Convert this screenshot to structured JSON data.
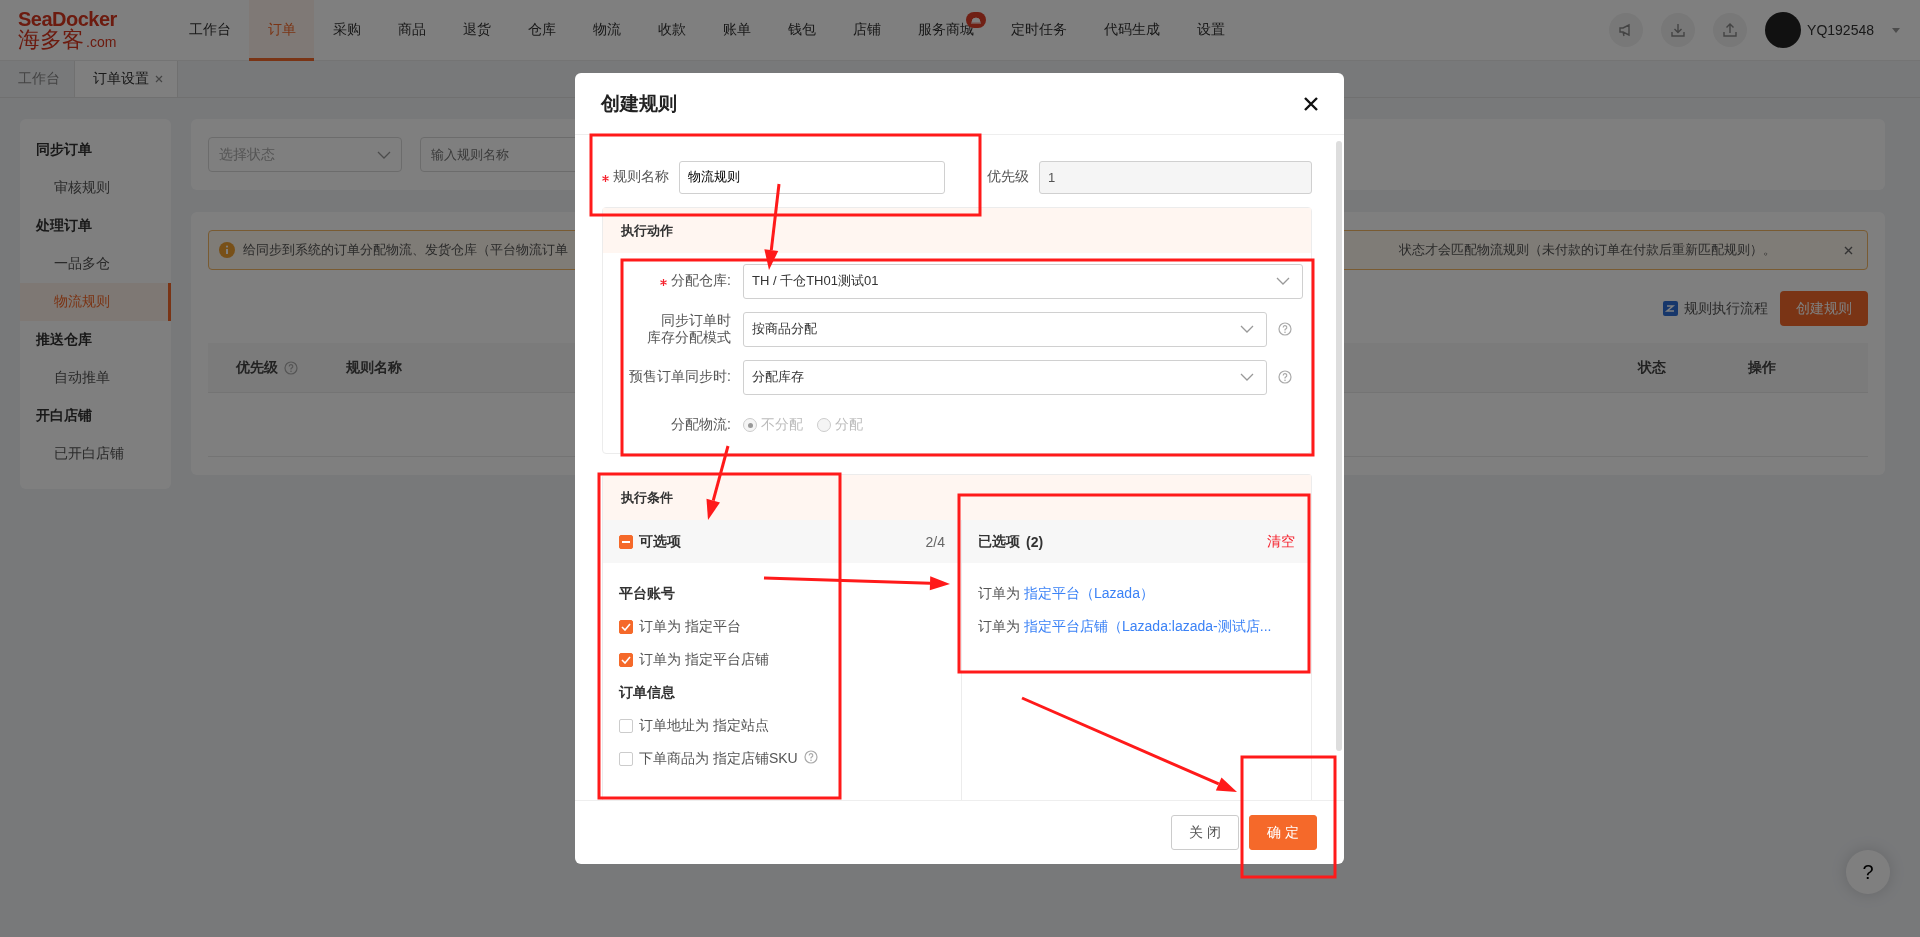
{
  "header": {
    "logo": {
      "brand": "SeaDocker",
      "name": "海多客",
      "suffix": ".com"
    },
    "nav": [
      {
        "label": "工作台",
        "selected": false,
        "badge": false
      },
      {
        "label": "订单",
        "selected": true,
        "badge": false
      },
      {
        "label": "采购",
        "selected": false,
        "badge": false
      },
      {
        "label": "商品",
        "selected": false,
        "badge": false
      },
      {
        "label": "退货",
        "selected": false,
        "badge": false
      },
      {
        "label": "仓库",
        "selected": false,
        "badge": false
      },
      {
        "label": "物流",
        "selected": false,
        "badge": false
      },
      {
        "label": "收款",
        "selected": false,
        "badge": false
      },
      {
        "label": "账单",
        "selected": false,
        "badge": false
      },
      {
        "label": "钱包",
        "selected": false,
        "badge": false
      },
      {
        "label": "店铺",
        "selected": false,
        "badge": false
      },
      {
        "label": "服务商城",
        "selected": false,
        "badge": true
      },
      {
        "label": "定时任务",
        "selected": false,
        "badge": false
      },
      {
        "label": "代码生成",
        "selected": false,
        "badge": false
      },
      {
        "label": "设置",
        "selected": false,
        "badge": false
      }
    ],
    "user": "YQ192548"
  },
  "tabs": [
    {
      "label": "工作台",
      "selected": false,
      "closable": false
    },
    {
      "label": "订单设置",
      "selected": true,
      "closable": true
    }
  ],
  "sidebar": {
    "groups": [
      {
        "title": "同步订单",
        "items": [
          {
            "label": "审核规则",
            "selected": false
          }
        ]
      },
      {
        "title": "处理订单",
        "items": [
          {
            "label": "一品多仓",
            "selected": false
          },
          {
            "label": "物流规则",
            "selected": true
          }
        ]
      },
      {
        "title": "推送仓库",
        "items": [
          {
            "label": "自动推单",
            "selected": false
          }
        ]
      },
      {
        "title": "开白店铺",
        "items": [
          {
            "label": "已开白店铺",
            "selected": false
          }
        ]
      }
    ]
  },
  "filters": {
    "status": {
      "placeholder": "选择状态"
    },
    "name": {
      "placeholder": "输入规则名称"
    }
  },
  "alert": {
    "text_start": "给同步到系统的订单分配物流、发货仓库（平台物流订单",
    "text_end": "状态才会匹配物流规则（未付款的订单在付款后重新匹配规则）。"
  },
  "actions": {
    "flow_link": "规则执行流程",
    "create_button": "创建规则"
  },
  "table": {
    "columns": [
      {
        "label": "优先级",
        "help": true
      },
      {
        "label": "规则名称",
        "help": false
      },
      {
        "label": "状态",
        "help": false
      },
      {
        "label": "操作",
        "help": false
      }
    ]
  },
  "help_button": "?",
  "modal": {
    "title": "创建规则",
    "name_field": {
      "label": "规则名称",
      "required": true,
      "value": "物流规则"
    },
    "priority_field": {
      "label": "优先级",
      "value": "1",
      "disabled": true
    },
    "action_section": {
      "title": "执行动作",
      "fields": [
        {
          "kind": "select",
          "label_lines": [
            "分配仓库:"
          ],
          "required": true,
          "value": "TH / 千仓TH01测试01",
          "help": false
        },
        {
          "kind": "select",
          "label_lines": [
            "同步订单时",
            "库存分配模式"
          ],
          "required": false,
          "value": "按商品分配",
          "help": true
        },
        {
          "kind": "select",
          "label_lines": [
            "预售订单同步时:"
          ],
          "required": false,
          "value": "分配库存",
          "help": true
        },
        {
          "kind": "radio",
          "label_lines": [
            "分配物流:"
          ],
          "required": false,
          "disabled": true,
          "help": false,
          "options": [
            {
              "label": "不分配",
              "selected": true
            },
            {
              "label": "分配",
              "selected": false
            }
          ]
        }
      ]
    },
    "condition_section": {
      "title": "执行条件",
      "available": {
        "title": "可选项",
        "count": "2/4",
        "indeterminate": true,
        "groups": [
          {
            "title": "平台账号",
            "items": [
              {
                "label": "订单为 指定平台",
                "checked": true,
                "help": false
              },
              {
                "label": "订单为 指定平台店铺",
                "checked": true,
                "help": false
              }
            ]
          },
          {
            "title": "订单信息",
            "items": [
              {
                "label": "订单地址为 指定站点",
                "checked": false,
                "help": false
              },
              {
                "label": "下单商品为 指定店铺SKU",
                "checked": false,
                "help": true
              }
            ]
          }
        ]
      },
      "chosen": {
        "title": "已选项",
        "count": "(2)",
        "clear": "清空",
        "items": [
          {
            "prefix": "订单为",
            "value": "指定平台（Lazada）"
          },
          {
            "prefix": "订单为",
            "value": "指定平台店铺（Lazada:lazada-测试店..."
          }
        ]
      }
    },
    "buttons": [
      {
        "label": "关 闭",
        "kind": "default"
      },
      {
        "label": "确 定",
        "kind": "primary"
      }
    ]
  }
}
